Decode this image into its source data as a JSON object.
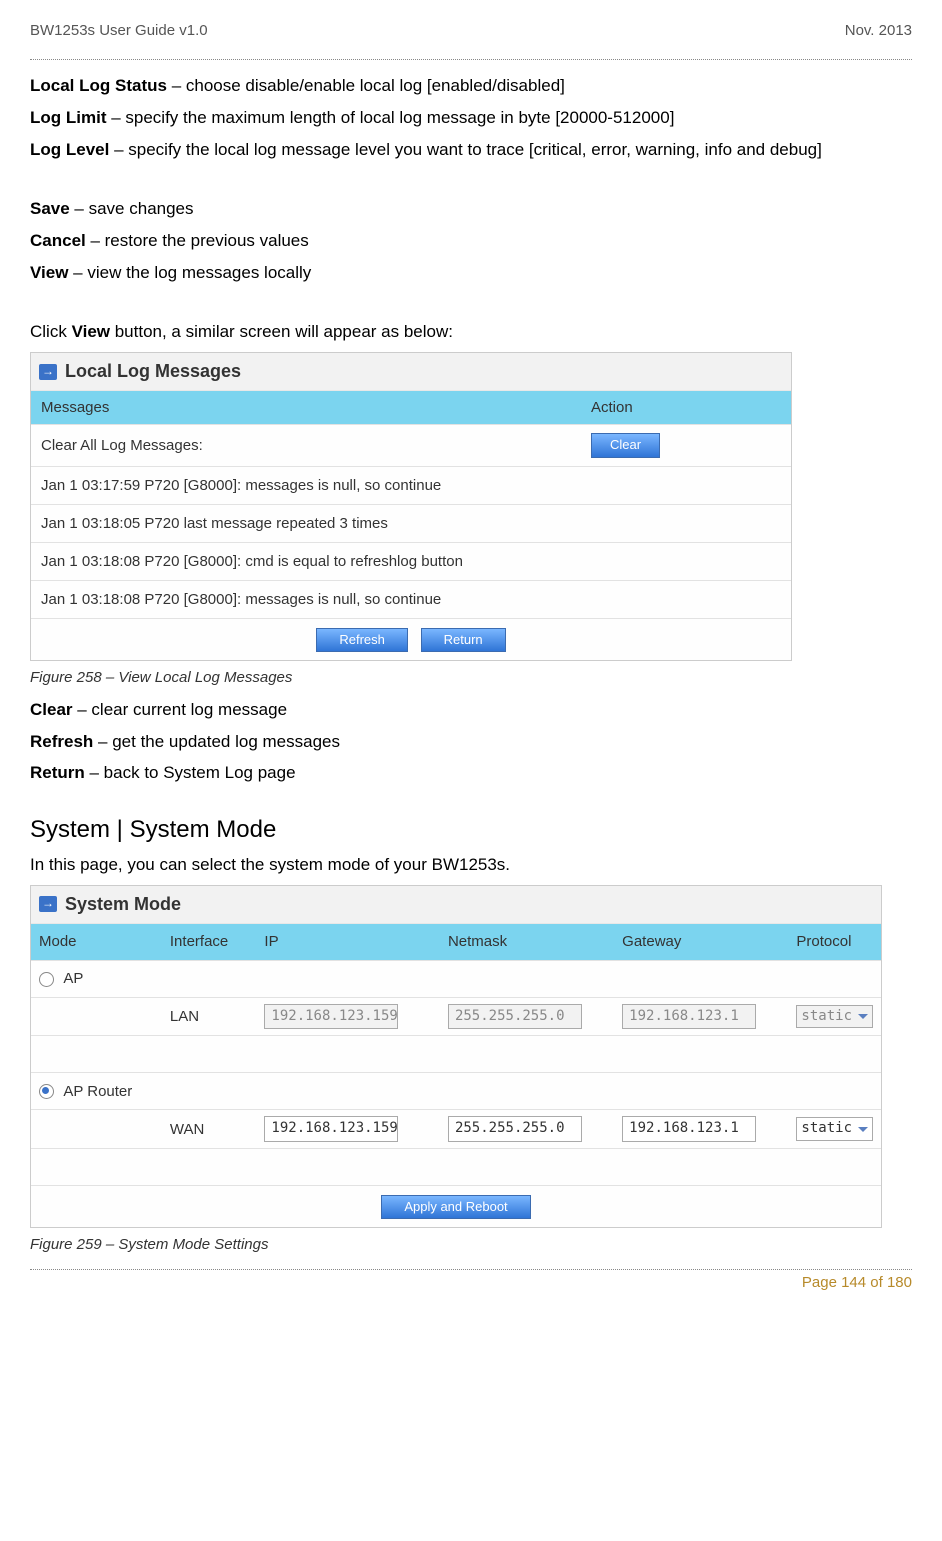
{
  "header": {
    "left": "BW1253s User Guide v1.0",
    "right": "Nov.  2013"
  },
  "defs": [
    {
      "term": "Local Log Status",
      "desc": " – choose disable/enable local log [enabled/disabled]"
    },
    {
      "term": "Log Limit",
      "desc": " – specify the maximum length of local log message in byte [20000-512000]"
    },
    {
      "term": "Log Level",
      "desc": " – specify the local log message level you want to trace [critical, error, warning, info and debug]"
    }
  ],
  "actions1": [
    {
      "term": "Save",
      "desc": " – save changes"
    },
    {
      "term": "Cancel",
      "desc": " – restore the previous values"
    },
    {
      "term": "View",
      "desc": " – view the log messages locally"
    }
  ],
  "click_view_pre": "Click ",
  "click_view_bold": "View",
  "click_view_post": " button, a similar screen will appear as below:",
  "log_panel": {
    "title": "Local Log Messages",
    "col_msg": "Messages",
    "col_act": "Action",
    "clear_row_label": "Clear All Log Messages:",
    "clear_btn": "Clear",
    "rows": [
      "Jan 1 03:17:59 P720 [G8000]: messages is null, so continue",
      "Jan 1 03:18:05 P720 last message repeated 3 times",
      "Jan 1 03:18:08 P720 [G8000]: cmd is equal to refreshlog button",
      "Jan 1 03:18:08 P720 [G8000]: messages is null, so continue"
    ],
    "refresh_btn": "Refresh",
    "return_btn": "Return"
  },
  "fig258": "Figure 258 – View Local Log Messages",
  "actions2": [
    {
      "term": "Clear",
      "desc": " – clear current log message"
    },
    {
      "term": "Refresh",
      "desc": " – get the updated log messages"
    },
    {
      "term": "Return",
      "desc": " – back to System Log page"
    }
  ],
  "sm_heading": "System | System Mode",
  "sm_intro": "In this page, you can select the system mode of your BW1253s.",
  "sm_panel": {
    "title": "System Mode",
    "cols": [
      "Mode",
      "Interface",
      "IP",
      "Netmask",
      "Gateway",
      "Protocol"
    ],
    "ap_label": "AP",
    "lan_label": "LAN",
    "lan_ip": "192.168.123.159",
    "lan_mask": "255.255.255.0",
    "lan_gw": "192.168.123.1",
    "lan_proto": "static",
    "apr_label": "AP Router",
    "wan_label": "WAN",
    "wan_ip": "192.168.123.159",
    "wan_mask": "255.255.255.0",
    "wan_gw": "192.168.123.1",
    "wan_proto": "static",
    "apply_btn": "Apply and Reboot"
  },
  "fig259": "Figure 259 – System Mode Settings",
  "page_no": "Page 144 of 180"
}
